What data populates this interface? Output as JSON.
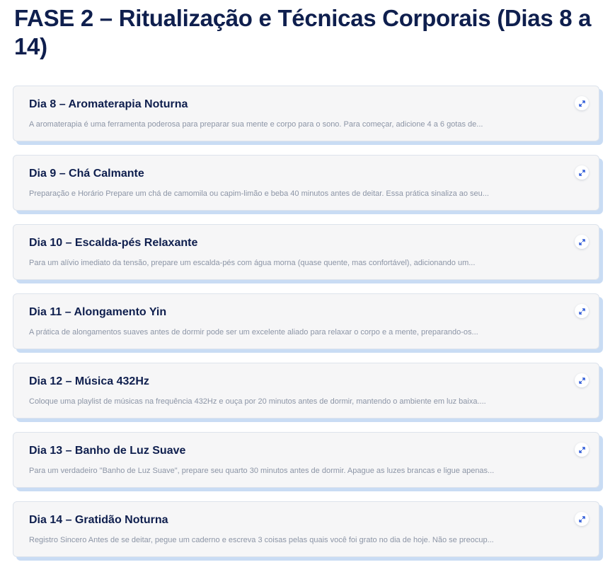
{
  "phase": {
    "title": "FASE 2 – Ritualização e Técnicas Corporais (Dias 8 a 14)"
  },
  "colors": {
    "title": "#0f1f4e",
    "excerpt": "#8c95a6",
    "card_background": "#f6f6f7",
    "card_shadow": "#c9dcf4",
    "expand_icon": "#1f4fd6"
  },
  "cards": [
    {
      "title": "Dia 8 – Aromaterapia Noturna",
      "excerpt": "A aromaterapia é uma ferramenta poderosa para preparar sua mente e corpo para o sono. Para começar, adicione 4 a 6 gotas de...",
      "icon": "expand-icon"
    },
    {
      "title": "Dia 9 – Chá Calmante",
      "excerpt": "Preparação e Horário Prepare um chá de camomila ou capim-limão e beba 40 minutos antes de deitar. Essa prática sinaliza ao seu...",
      "icon": "expand-icon"
    },
    {
      "title": "Dia 10 – Escalda-pés Relaxante",
      "excerpt": "Para um alívio imediato da tensão, prepare um escalda-pés com água morna (quase quente, mas confortável), adicionando um...",
      "icon": "expand-icon"
    },
    {
      "title": "Dia 11 – Alongamento Yin",
      "excerpt": "A prática de alongamentos suaves antes de dormir pode ser um excelente aliado para relaxar o corpo e a mente, preparando-os...",
      "icon": "expand-icon"
    },
    {
      "title": "Dia 12 – Música 432Hz",
      "excerpt": "Coloque uma playlist de músicas na frequência 432Hz e ouça por 20 minutos antes de dormir, mantendo o ambiente em luz baixa....",
      "icon": "expand-icon"
    },
    {
      "title": "Dia 13 – Banho de Luz Suave",
      "excerpt": "Para um verdadeiro \"Banho de Luz Suave\", prepare seu quarto 30 minutos antes de dormir. Apague as luzes brancas e ligue apenas...",
      "icon": "expand-icon"
    },
    {
      "title": "Dia 14 – Gratidão Noturna",
      "excerpt": "Registro Sincero Antes de se deitar, pegue um caderno e escreva 3 coisas pelas quais você foi grato no dia de hoje. Não se preocup...",
      "icon": "expand-icon"
    }
  ]
}
